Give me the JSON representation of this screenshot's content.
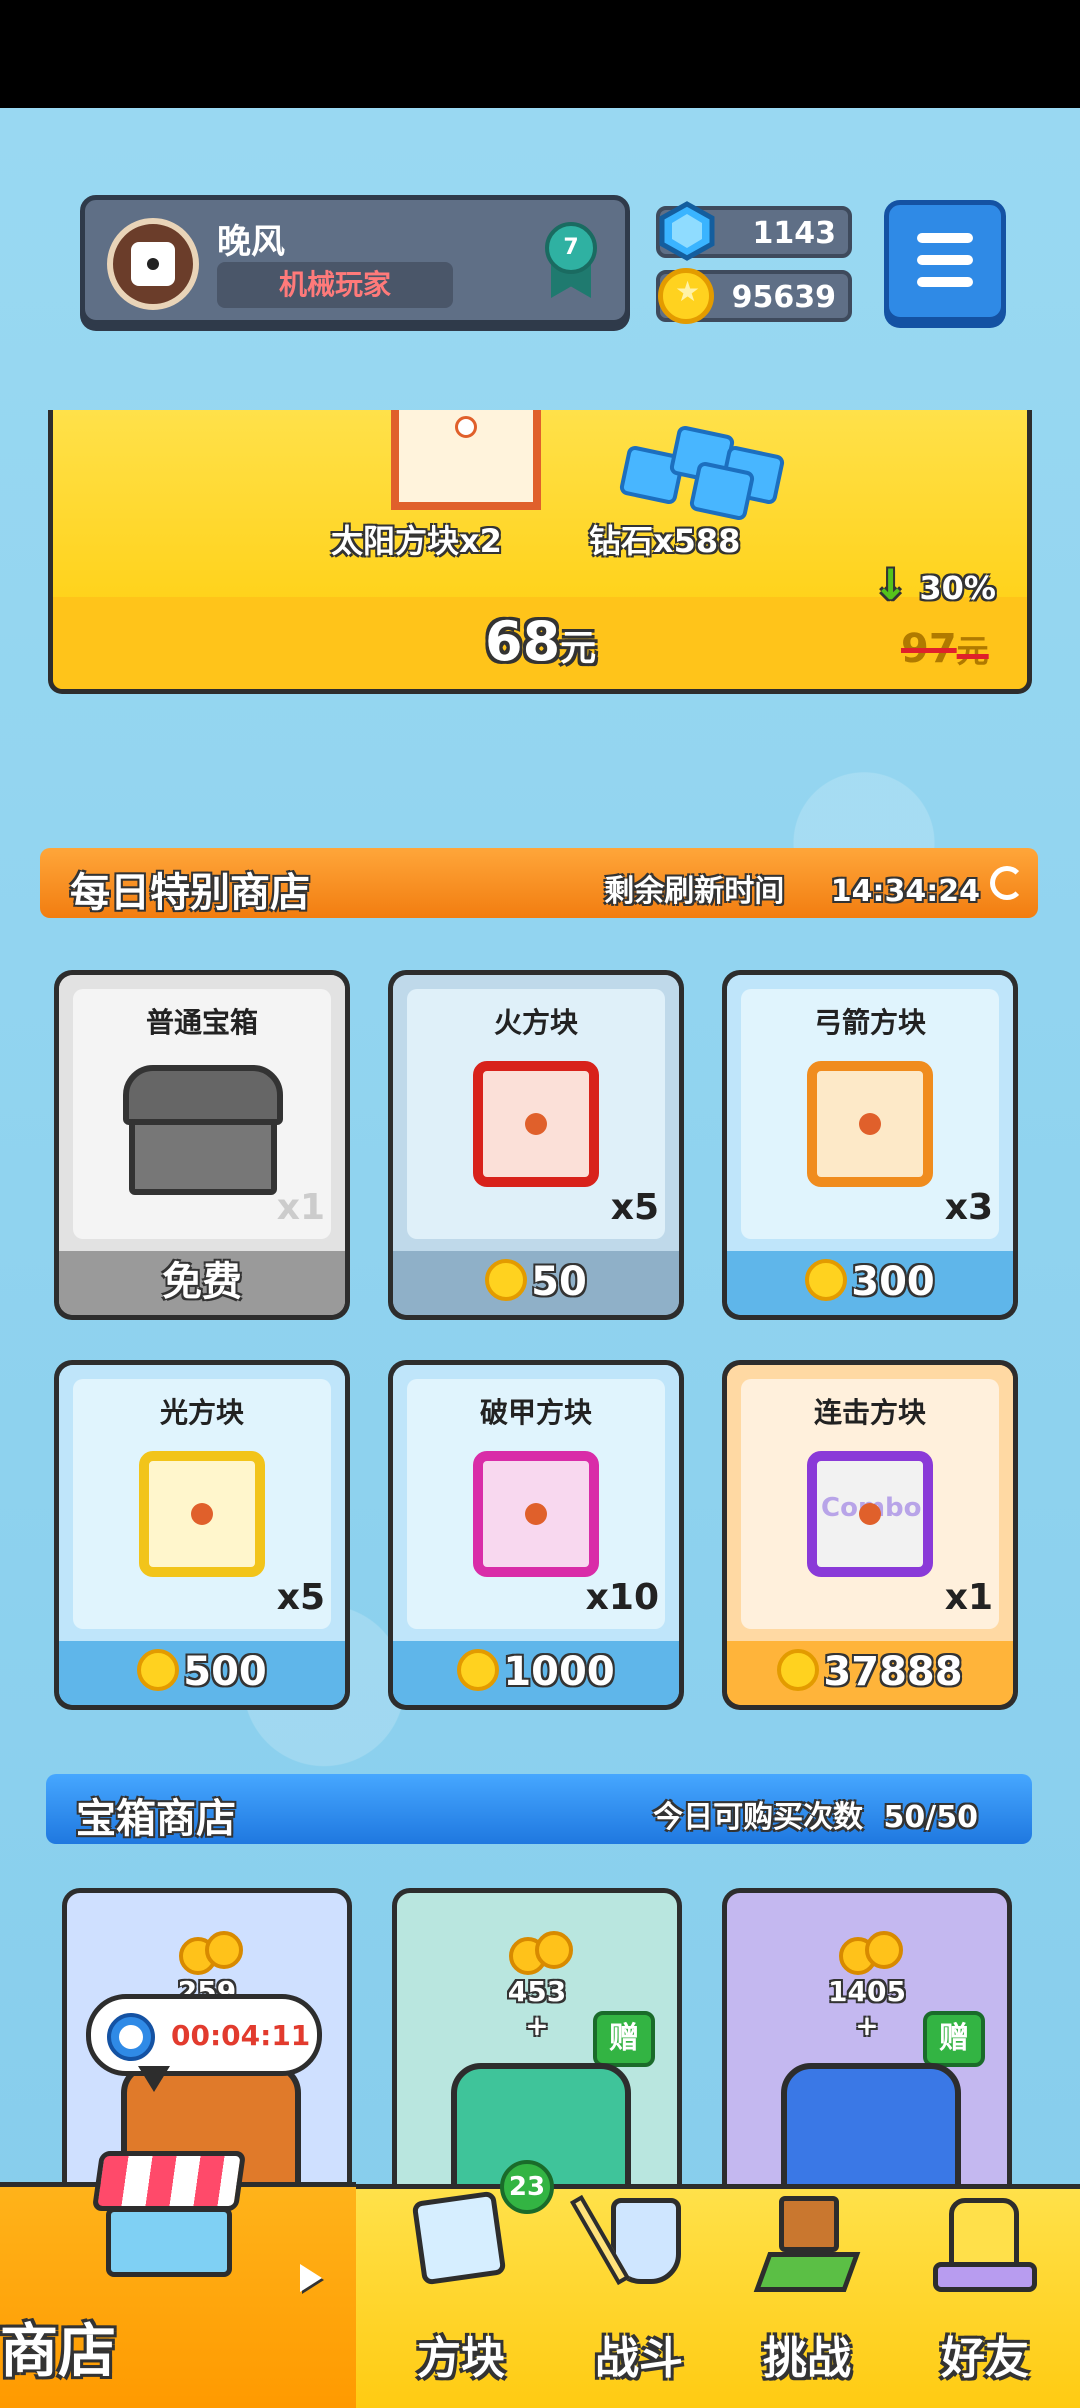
{
  "player": {
    "name": "晚风",
    "title": "机械玩家",
    "rank": "7"
  },
  "currency": {
    "gems": "1143",
    "coins": "95639"
  },
  "banner": {
    "item1_label": "太阳方块x2",
    "item2_label": "钻石x588",
    "price_value": "68",
    "price_unit": "元",
    "discount": "30%",
    "old_price": "97",
    "old_price_unit": "元"
  },
  "daily_shop": {
    "title": "每日特别商店",
    "refresh_label": "剩余刷新时间",
    "refresh_time": "14:34:24",
    "items": [
      {
        "name": "普通宝箱",
        "qty": "x1",
        "price": "免费"
      },
      {
        "name": "火方块",
        "qty": "x5",
        "price": "50"
      },
      {
        "name": "弓箭方块",
        "qty": "x3",
        "price": "300"
      },
      {
        "name": "光方块",
        "qty": "x5",
        "price": "500"
      },
      {
        "name": "破甲方块",
        "qty": "x10",
        "price": "1000"
      },
      {
        "name": "连击方块",
        "qty": "x1",
        "price": "37888",
        "block_text": "Combo"
      }
    ]
  },
  "chest_shop": {
    "title": "宝箱商店",
    "purchases_label": "今日可购买次数",
    "purchases_value": "50/50",
    "timer": "00:04:11",
    "chests": [
      {
        "count": "259"
      },
      {
        "count": "453",
        "plus": "+",
        "gift": "赠"
      },
      {
        "count": "1405",
        "plus": "+",
        "gift": "赠"
      }
    ]
  },
  "nav": {
    "shop": "商店",
    "blocks": "方块",
    "battle": "战斗",
    "challenge": "挑战",
    "friends": "好友",
    "blocks_badge": "23"
  },
  "colors": {
    "accent_orange": "#f27d10",
    "accent_blue": "#1f78e0",
    "nav_yellow": "#ffcb12",
    "price_red": "#e23b2e"
  }
}
